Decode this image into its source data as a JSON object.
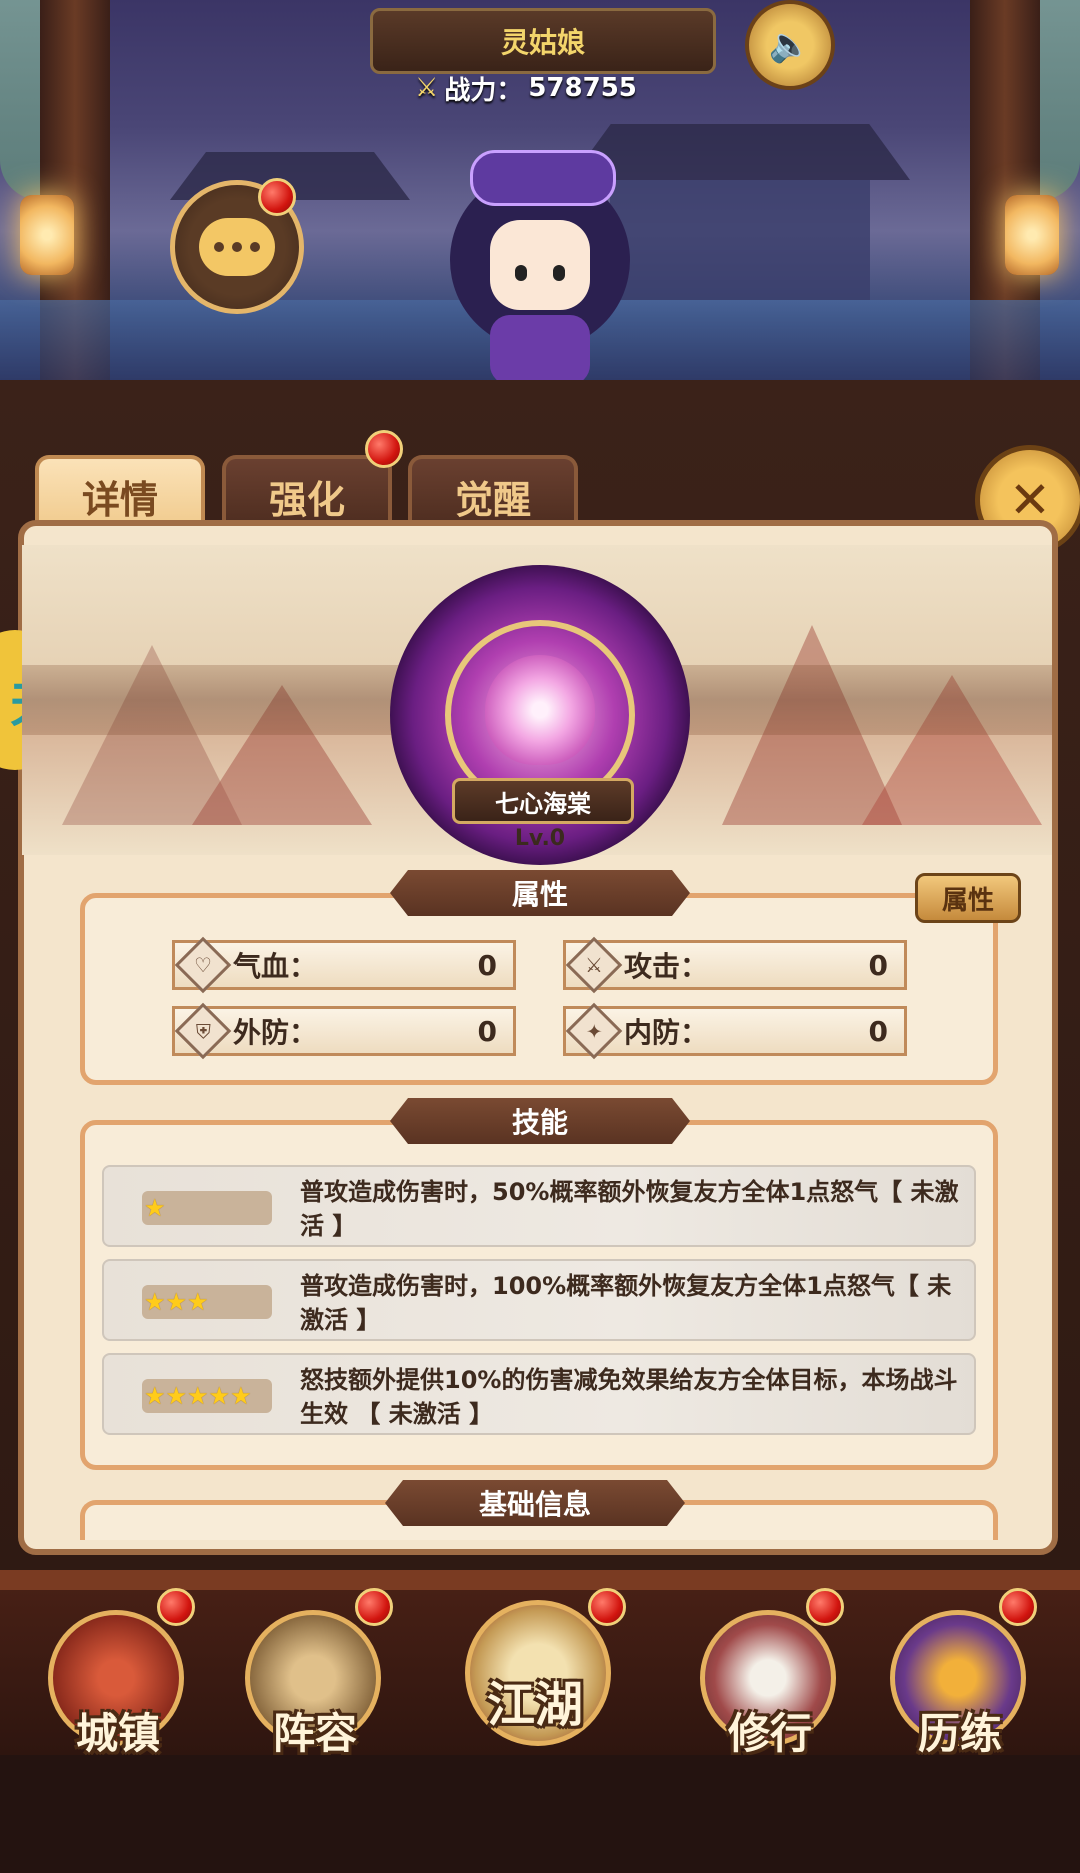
{
  "header": {
    "character_name": "灵姑娘",
    "power_label": "战力：",
    "power_value": "578755"
  },
  "tabs": [
    {
      "label": "详情",
      "active": true
    },
    {
      "label": "强化",
      "active": false,
      "badge": true
    },
    {
      "label": "觉醒",
      "active": false
    }
  ],
  "side_badge_text": "天",
  "skill": {
    "name": "七心海棠",
    "level": "Lv.0"
  },
  "attributes": {
    "title": "属性",
    "button_label": "属性",
    "stats": [
      {
        "label": "气血：",
        "value": "0",
        "icon": "heart-icon"
      },
      {
        "label": "攻击：",
        "value": "0",
        "icon": "sword-icon"
      },
      {
        "label": "外防：",
        "value": "0",
        "icon": "shield-icon"
      },
      {
        "label": "内防：",
        "value": "0",
        "icon": "flame-icon"
      }
    ]
  },
  "skills": {
    "title": "技能",
    "rows": [
      {
        "stars": 1,
        "text": "普攻造成伤害时，50%概率额外恢复友方全体1点怒气【 未激活 】"
      },
      {
        "stars": 3,
        "text": "普攻造成伤害时，100%概率额外恢复友方全体1点怒气【 未激活 】"
      },
      {
        "stars": 5,
        "text": "怒技额外提供10%的伤害减免效果给友方全体目标，本场战斗生效 【 未激活 】"
      }
    ]
  },
  "basic_info": {
    "title": "基础信息"
  },
  "bottom_nav": [
    {
      "label": "城镇",
      "icon": "town-icon",
      "badge": true
    },
    {
      "label": "阵容",
      "icon": "lineup-icon",
      "badge": true
    },
    {
      "label": "江湖",
      "icon": "scroll-icon",
      "badge": true
    },
    {
      "label": "修行",
      "icon": "cultivation-icon",
      "badge": true
    },
    {
      "label": "历练",
      "icon": "trial-icon",
      "badge": true
    }
  ],
  "colors": {
    "accent_gold": "#f3d56b",
    "panel_bg": "#f4e5cc",
    "badge_red": "#d2150f",
    "star": "#ffcc1a"
  }
}
